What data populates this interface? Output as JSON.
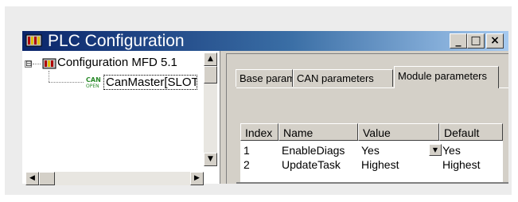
{
  "window": {
    "title": "PLC Configuration",
    "controls": {
      "minimize": "_",
      "maximize": "□",
      "close": "×"
    }
  },
  "tree": {
    "root_label": "Configuration MFD 5.1",
    "child_label": "CanMaster[SLOT]",
    "expander": "⊟"
  },
  "scrollbar": {
    "up": "▲",
    "down": "▼",
    "left": "◀",
    "right": "▶"
  },
  "tabs": [
    {
      "label": "Base parameters",
      "active": false
    },
    {
      "label": "CAN parameters",
      "active": false
    },
    {
      "label": "Module parameters",
      "active": true
    }
  ],
  "table": {
    "columns": [
      "Index",
      "Name",
      "Value",
      "Default"
    ],
    "rows": [
      {
        "index": "1",
        "name": "EnableDiags",
        "value": "Yes",
        "default": "Yes"
      },
      {
        "index": "2",
        "name": "UpdateTask",
        "value": "Highest",
        "default": "Highest"
      }
    ],
    "dropdown_arrow": "▼"
  },
  "colors": {
    "titlebar_start": "#0a246a",
    "titlebar_end": "#a6caf0",
    "face": "#d4d0c8"
  }
}
